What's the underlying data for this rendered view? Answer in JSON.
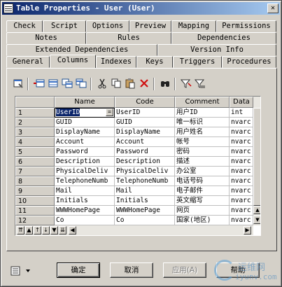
{
  "window": {
    "title": "Table Properties - User (User)",
    "close_glyph": "✕"
  },
  "tabs": {
    "row1": [
      "Check",
      "Script",
      "Options",
      "Preview",
      "Mapping",
      "Permissions"
    ],
    "row2": [
      "Notes",
      "Rules",
      "Dependencies"
    ],
    "row3": [
      "Extended Dependencies",
      "Version Info"
    ],
    "row4": [
      "General",
      "Columns",
      "Indexes",
      "Keys",
      "Triggers",
      "Procedures"
    ],
    "active": "Columns"
  },
  "toolbar": {
    "icons": [
      "properties-icon",
      "insert-row-icon",
      "add-row-icon",
      "add-columns-icon",
      "move-columns-icon",
      "cut-icon",
      "copy-icon",
      "paste-icon",
      "delete-icon",
      "find-icon",
      "filter-icon",
      "sort-icon"
    ]
  },
  "grid": {
    "headers": [
      "",
      "Name",
      "Code",
      "Comment",
      "Data"
    ],
    "rows": [
      {
        "num": "1",
        "name": "UserID",
        "code": "UserID",
        "comment": "用户ID",
        "data": "int"
      },
      {
        "num": "2",
        "name": "GUID",
        "code": "GUID",
        "comment": "唯一标识",
        "data": "nvarc"
      },
      {
        "num": "3",
        "name": "DisplayName",
        "code": "DisplayName",
        "comment": "用户姓名",
        "data": "nvarc"
      },
      {
        "num": "4",
        "name": "Account",
        "code": "Account",
        "comment": "帐号",
        "data": "nvarc"
      },
      {
        "num": "5",
        "name": "Password",
        "code": "Password",
        "comment": "密码",
        "data": "nvarc"
      },
      {
        "num": "6",
        "name": "Description",
        "code": "Description",
        "comment": "描述",
        "data": "nvarc"
      },
      {
        "num": "7",
        "name": "PhysicalDeliv",
        "code": "PhysicalDeliv",
        "comment": "办公室",
        "data": "nvarc"
      },
      {
        "num": "8",
        "name": "TelephoneNumb",
        "code": "TelephoneNumb",
        "comment": "电话号码",
        "data": "nvarc"
      },
      {
        "num": "9",
        "name": "Mail",
        "code": "Mail",
        "comment": "电子邮件",
        "data": "nvarc"
      },
      {
        "num": "10",
        "name": "Initials",
        "code": "Initials",
        "comment": "英文缩写",
        "data": "nvarc"
      },
      {
        "num": "11",
        "name": "WWWHomePage",
        "code": "WWWHomePage",
        "comment": "网页",
        "data": "nvarc"
      },
      {
        "num": "12",
        "name": "Co",
        "code": "Co",
        "comment": "国家(地区)",
        "data": "nvarc"
      }
    ]
  },
  "buttons": {
    "ok": "确定",
    "cancel": "取消",
    "apply": "应用(A)",
    "help": "帮助"
  },
  "watermark": {
    "line1": "运维网",
    "line2": "iyunv.com"
  },
  "colors": {
    "title_bar": "#0a246a",
    "selection": "#0a246a",
    "face": "#d4d0c8"
  }
}
